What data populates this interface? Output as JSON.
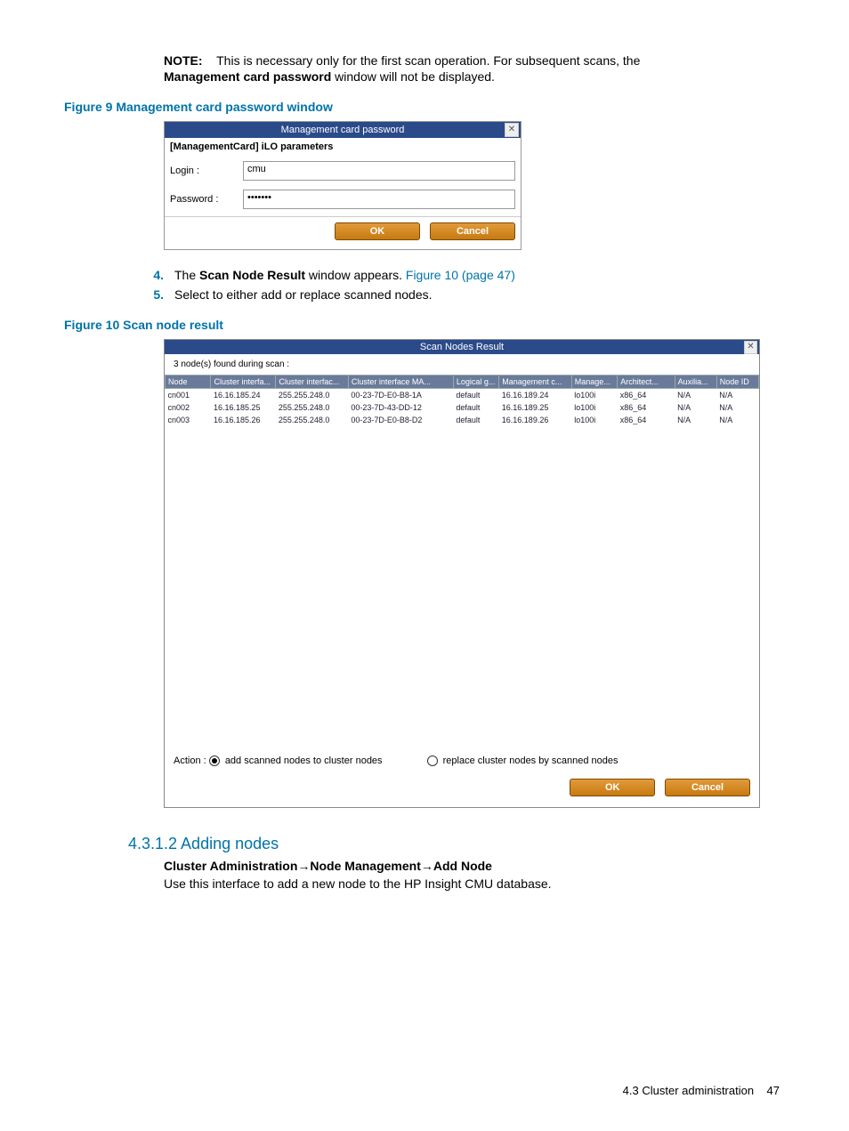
{
  "note": {
    "label": "NOTE:",
    "line1": "This is necessary only for the first scan operation. For subsequent scans, the",
    "bold_in_line2": "Management card password",
    "line2_rest": " window will not be displayed."
  },
  "fig9": {
    "caption": "Figure 9 Management card password window",
    "title": "Management card password",
    "close_x": "✕",
    "params_title": "[ManagementCard] iLO parameters",
    "login_label": "Login :",
    "login_value": "cmu",
    "password_label": "Password :",
    "password_value": "•••••••",
    "ok": "OK",
    "cancel": "Cancel"
  },
  "steps": {
    "s4_num": "4.",
    "s4_a": "The ",
    "s4_bold": "Scan Node Result",
    "s4_b": " window appears. ",
    "s4_link": "Figure 10 (page 47)",
    "s5_num": "5.",
    "s5": "Select to either add or replace scanned nodes."
  },
  "fig10": {
    "caption": "Figure 10 Scan node result",
    "title": "Scan Nodes Result",
    "close_x": "✕",
    "found": "3 node(s) found during scan :",
    "headers": [
      "Node",
      "Cluster interfa...",
      "Cluster interfac...",
      "Cluster interface MA...",
      "Logical g...",
      "Management c...",
      "Manage...",
      "Architect...",
      "Auxilia...",
      "Node ID"
    ],
    "col_widths": [
      "48",
      "68",
      "76",
      "110",
      "48",
      "76",
      "48",
      "60",
      "44",
      "44"
    ],
    "rows": [
      [
        "cn001",
        "16.16.185.24",
        "255.255.248.0",
        "00-23-7D-E0-B8-1A",
        "default",
        "16.16.189.24",
        "lo100i",
        "x86_64",
        "N/A",
        "N/A"
      ],
      [
        "cn002",
        "16.16.185.25",
        "255.255.248.0",
        "00-23-7D-43-DD-12",
        "default",
        "16.16.189.25",
        "lo100i",
        "x86_64",
        "N/A",
        "N/A"
      ],
      [
        "cn003",
        "16.16.185.26",
        "255.255.248.0",
        "00-23-7D-E0-B8-D2",
        "default",
        "16.16.189.26",
        "lo100i",
        "x86_64",
        "N/A",
        "N/A"
      ]
    ],
    "action_label": "Action :",
    "opt1": "add scanned nodes to cluster nodes",
    "opt2": "replace cluster nodes by scanned nodes",
    "ok": "OK",
    "cancel": "Cancel"
  },
  "section": {
    "heading": "4.3.1.2 Adding nodes",
    "bc1": "Cluster Administration",
    "bc2": "Node Management",
    "bc3": "Add Node",
    "arrow": "→",
    "body": "Use this interface to add a new node to the HP Insight CMU database."
  },
  "footer": {
    "text": "4.3 Cluster administration",
    "page": "47"
  }
}
